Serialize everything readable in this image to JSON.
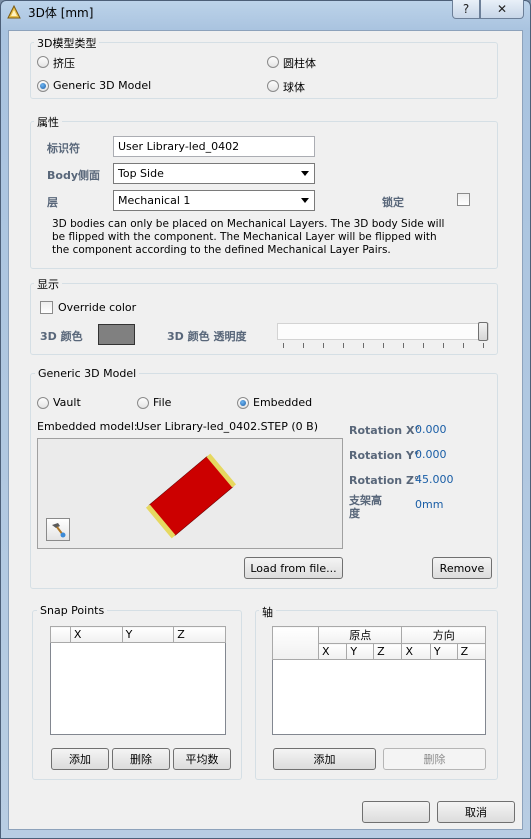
{
  "window": {
    "title": "3D体 [mm]",
    "help": "?",
    "close": "✕"
  },
  "model_type": {
    "title": "3D模型类型",
    "options": [
      "挤压",
      "圆柱体",
      "Generic 3D Model",
      "球体"
    ],
    "selected": "Generic 3D Model"
  },
  "properties": {
    "title": "属性",
    "identifier_label": "标识符",
    "identifier_value": "User Library-led_0402",
    "body_side_label": "Body侧面",
    "body_side_value": "Top Side",
    "layer_label": "层",
    "layer_value": "Mechanical 1",
    "lock_label": "锁定",
    "lock_checked": false,
    "note": "3D bodies can only be placed on Mechanical Layers. The 3D body Side will be flipped with the component. The Mechanical Layer will be flipped with the component according to the defined Mechanical Layer Pairs."
  },
  "display": {
    "title": "显示",
    "override_label": "Override color",
    "override_checked": false,
    "color_label": "3D 颜色",
    "color_value": "#808080",
    "opacity_label": "3D 颜色 透明度",
    "opacity_level": 1.0
  },
  "generic": {
    "title": "Generic 3D Model",
    "sources": [
      "Vault",
      "File",
      "Embedded"
    ],
    "selected_source": "Embedded",
    "embedded_label": "Embedded model:",
    "embedded_value": "User Library-led_0402.STEP (0 B)",
    "rotation_x_label": "Rotation X°",
    "rotation_x_value": "0.000",
    "rotation_y_label": "Rotation Y°",
    "rotation_y_value": "0.000",
    "rotation_z_label": "Rotation Z°",
    "rotation_z_value": "45.000",
    "standoff_label_1": "支架高",
    "standoff_label_2": "度",
    "standoff_value": "0mm",
    "load_button": "Load from file...",
    "remove_button": "Remove",
    "body_color": "#cc0000",
    "pad_color": "#e6d860"
  },
  "snap_points": {
    "title": "Snap Points",
    "columns": [
      "X",
      "Y",
      "Z"
    ],
    "add": "添加",
    "delete": "删除",
    "average": "平均数"
  },
  "axis": {
    "title": "轴",
    "group_origin": "原点",
    "group_direction": "方向",
    "columns": [
      "X",
      "Y",
      "Z",
      "X",
      "Y",
      "Z"
    ],
    "add": "添加",
    "delete": "删除"
  },
  "footer": {
    "cancel": "取消"
  }
}
